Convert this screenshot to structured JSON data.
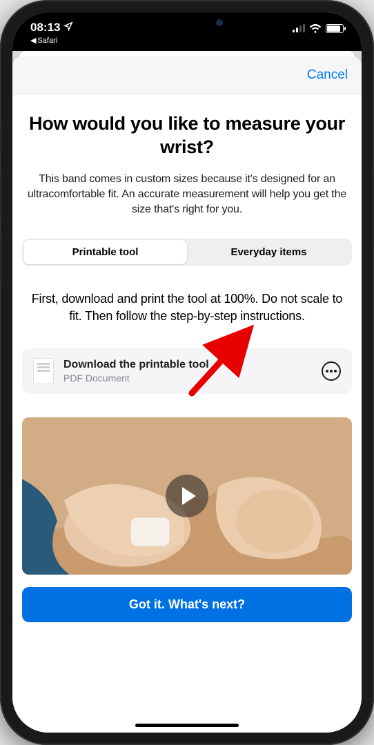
{
  "status": {
    "time": "08:13",
    "back_app": "Safari"
  },
  "sheet": {
    "cancel": "Cancel",
    "title": "How would you like to measure your wrist?",
    "subtitle": "This band comes in custom sizes because it's designed for an ultracomfortable fit. An accurate measurement will help you get the size that's right for you.",
    "segments": {
      "printable": "Printable tool",
      "everyday": "Everyday items"
    },
    "instructions": "First, download and print the tool at 100%. Do not scale to fit. Then follow the step-by-step instructions.",
    "download": {
      "title": "Download the printable tool",
      "sub": "PDF Document"
    },
    "cta": "Got it. What's next?"
  }
}
